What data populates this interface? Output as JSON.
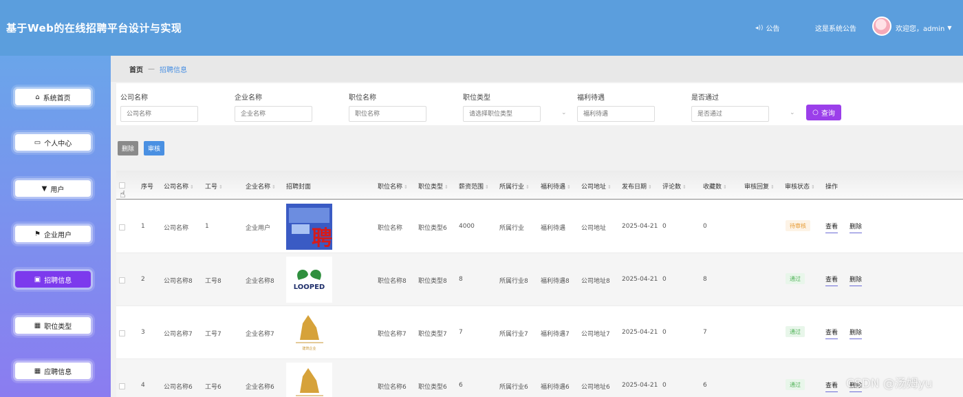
{
  "header": {
    "title": "基于Web的在线招聘平台设计与实现",
    "notice_label": "公告",
    "notice_icon": "megaphone-icon",
    "system_notice": "这是系统公告",
    "welcome": "欢迎您，admin",
    "dropdown_icon": "caret-down-icon"
  },
  "sidebar": {
    "items": [
      {
        "label": "系统首页",
        "icon": "home-icon"
      },
      {
        "label": "个人中心",
        "icon": "id-card-icon"
      },
      {
        "label": "用户",
        "icon": "user-icon"
      },
      {
        "label": "企业用户",
        "icon": "flag-icon"
      },
      {
        "label": "招聘信息",
        "icon": "briefcase-icon",
        "active": true
      },
      {
        "label": "职位类型",
        "icon": "grid-icon"
      },
      {
        "label": "应聘信息",
        "icon": "grid-icon"
      }
    ]
  },
  "breadcrumb": {
    "home": "首页",
    "separator": "—",
    "current": "招聘信息"
  },
  "filters": [
    {
      "label": "公司名称",
      "placeholder": "公司名称"
    },
    {
      "label": "企业名称",
      "placeholder": "企业名称"
    },
    {
      "label": "职位名称",
      "placeholder": "职位名称"
    },
    {
      "label": "职位类型",
      "placeholder": "请选择职位类型"
    },
    {
      "label": "福利待遇",
      "placeholder": "福利待遇"
    },
    {
      "label": "是否通过",
      "placeholder": "是否通过"
    }
  ],
  "search_button": "查询",
  "actions": {
    "delete": "删除",
    "audit": "审核"
  },
  "table": {
    "columns": [
      "序号",
      "公司名称",
      "工号",
      "企业名称",
      "招聘封面",
      "职位名称",
      "职位类型",
      "薪资范围",
      "所属行业",
      "福利待遇",
      "公司地址",
      "发布日期",
      "评论数",
      "收藏数",
      "审核回复",
      "审核状态",
      "操作"
    ],
    "rows": [
      {
        "index": "1",
        "company": "公司名称",
        "emp_no": "1",
        "enterprise": "企业用户",
        "cover_text": "聘",
        "job": "职位名称",
        "job_type": "职位类型6",
        "salary": "4000",
        "industry": "所属行业",
        "welfare": "福利待遇",
        "address": "公司地址",
        "date": "2025-04-21",
        "comments": "0",
        "favorites": "0",
        "reply": "",
        "status": "待审核",
        "status_kind": "pending"
      },
      {
        "index": "2",
        "company": "公司名称8",
        "emp_no": "工号8",
        "enterprise": "企业名称8",
        "cover_text": "LOOPED",
        "job": "职位名称8",
        "job_type": "职位类型8",
        "salary": "8",
        "industry": "所属行业8",
        "welfare": "福利待遇8",
        "address": "公司地址8",
        "date": "2025-04-21",
        "comments": "0",
        "favorites": "8",
        "reply": "",
        "status": "通过",
        "status_kind": "passed"
      },
      {
        "index": "3",
        "company": "公司名称7",
        "emp_no": "工号7",
        "enterprise": "企业名称7",
        "cover_text": "建筑企业",
        "job": "职位名称7",
        "job_type": "职位类型7",
        "salary": "7",
        "industry": "所属行业7",
        "welfare": "福利待遇7",
        "address": "公司地址7",
        "date": "2025-04-21",
        "comments": "0",
        "favorites": "7",
        "reply": "",
        "status": "通过",
        "status_kind": "passed"
      },
      {
        "index": "4",
        "company": "公司名称6",
        "emp_no": "工号6",
        "enterprise": "企业名称6",
        "cover_text": "",
        "job": "职位名称6",
        "job_type": "职位类型6",
        "salary": "6",
        "industry": "所属行业6",
        "welfare": "福利待遇6",
        "address": "公司地址6",
        "date": "2025-04-21",
        "comments": "0",
        "favorites": "6",
        "reply": "",
        "status": "通过",
        "status_kind": "passed"
      }
    ],
    "op_view": "查看",
    "op_delete": "删除"
  },
  "watermark": "CSDN @汤姆yu",
  "colors": {
    "header": "#5b9edd",
    "active_nav": "#7c3aed",
    "search_button": "#9b3fea",
    "audit_button": "#4a90e2"
  }
}
